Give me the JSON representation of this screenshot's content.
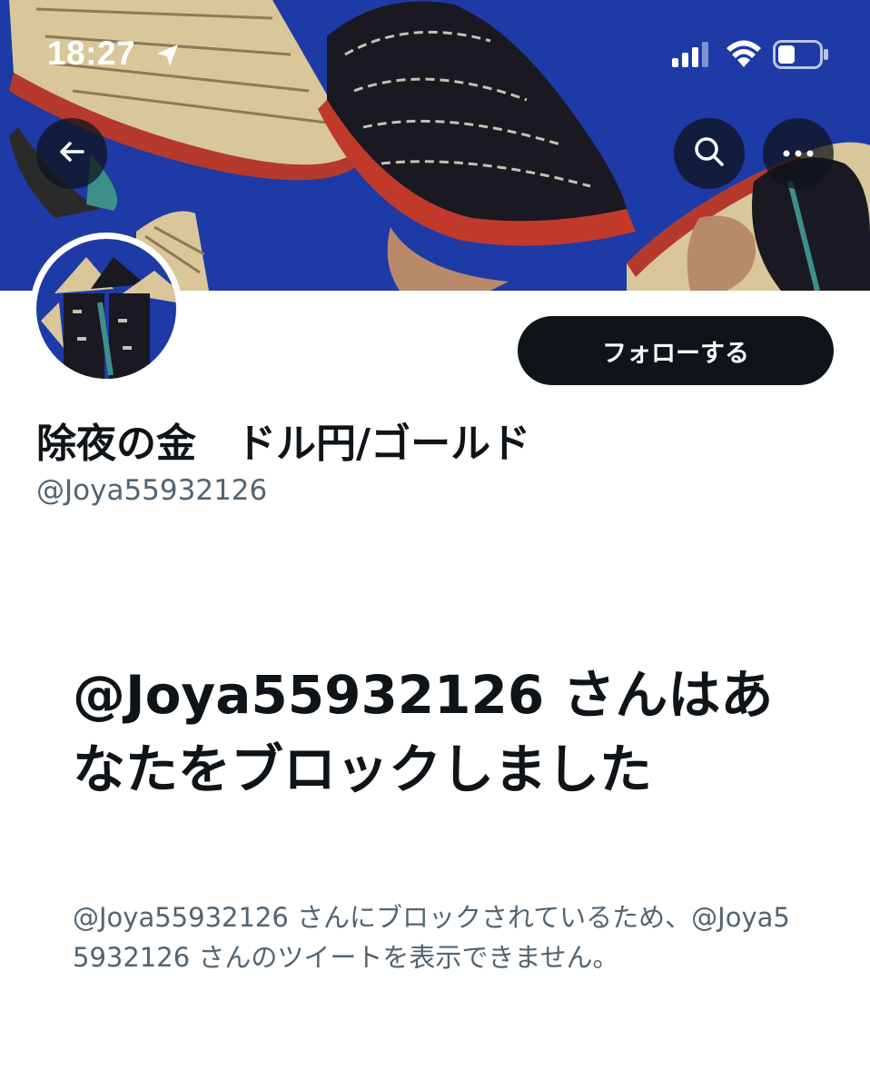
{
  "status_bar": {
    "time": "18:27",
    "icons": [
      "location-arrow-icon",
      "cellular-signal-icon",
      "wifi-icon",
      "battery-icon"
    ]
  },
  "header": {
    "back_icon": "arrow-left-icon",
    "search_icon": "search-icon",
    "more_icon": "more-horizontal-icon"
  },
  "profile": {
    "display_name": "除夜の金　ドル円/ゴールド",
    "handle": "@Joya55932126",
    "follow_label": "フォローする"
  },
  "blocked_notice": {
    "title": "@Joya55932126 さんはあなたをブロックしました",
    "description": "@Joya55932126 さんにブロックされているため、@Joya55932126 さんのツイートを表示できません。"
  },
  "colors": {
    "banner_blue": "#1d3aa6",
    "text_primary": "#0f1419",
    "text_secondary": "#536471",
    "button_dark": "#0f1419"
  }
}
